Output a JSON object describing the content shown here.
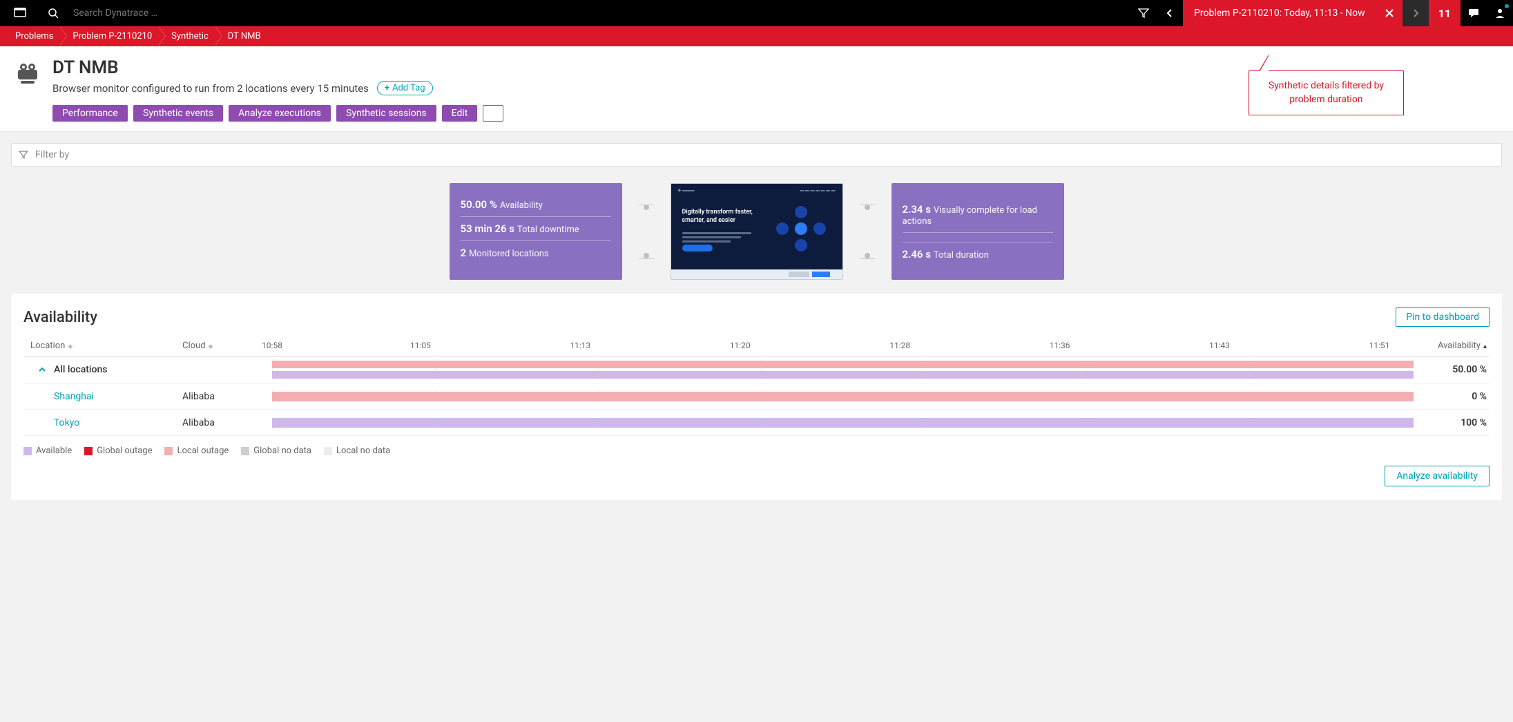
{
  "topnav": {
    "search_placeholder": "Search Dynatrace …",
    "problem_chip": "Problem P-2110210: Today, 11:13 - Now",
    "badge_count": "11"
  },
  "breadcrumbs": [
    "Problems",
    "Problem P-2110210",
    "Synthetic",
    "DT NMB"
  ],
  "header": {
    "title": "DT NMB",
    "subtitle": "Browser monitor configured to run from 2 locations every 15 minutes",
    "add_tag": "Add Tag",
    "actions": [
      "Performance",
      "Synthetic events",
      "Analyze executions",
      "Synthetic sessions",
      "Edit"
    ]
  },
  "callout": {
    "line1": "Synthetic details filtered by",
    "line2": "problem duration"
  },
  "filter_placeholder": "Filter by",
  "tiles": {
    "left": [
      {
        "value": "50.00 %",
        "label": "Availability"
      },
      {
        "value": "53 min 26 s",
        "label": "Total downtime"
      },
      {
        "value": "2",
        "label": "Monitored locations"
      }
    ],
    "right": [
      {
        "value": "2.34 s",
        "label": "Visually complete for load actions"
      },
      {
        "value": "2.46 s",
        "label": "Total duration"
      }
    ],
    "preview_headline": "Digitally transform faster, smarter, and easier"
  },
  "availability": {
    "title": "Availability",
    "pin": "Pin to dashboard",
    "analyze": "Analyze availability",
    "columns": {
      "location": "Location",
      "cloud": "Cloud",
      "availability": "Availability"
    },
    "ticks": [
      "10:58",
      "11:05",
      "11:13",
      "11:20",
      "11:28",
      "11:36",
      "11:43",
      "11:51"
    ],
    "rows": [
      {
        "name": "All locations",
        "cloud": "",
        "avail": "50.00 %",
        "expand": true
      },
      {
        "name": "Shanghai",
        "cloud": "Alibaba",
        "avail": "0 %",
        "link": true
      },
      {
        "name": "Tokyo",
        "cloud": "Alibaba",
        "avail": "100 %",
        "link": true
      }
    ],
    "legend": [
      "Available",
      "Global outage",
      "Local outage",
      "Global no data",
      "Local no data"
    ]
  }
}
